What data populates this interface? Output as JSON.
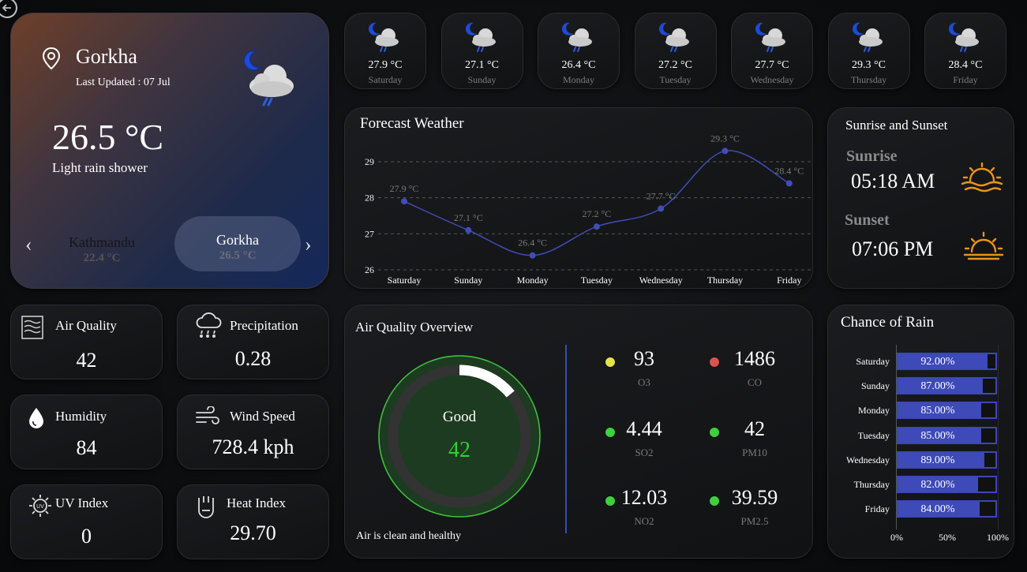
{
  "main": {
    "city": "Gorkha",
    "last_updated": "Last Updated : 07 Jul",
    "temperature": "26.5 °C",
    "condition": "Light rain shower",
    "carousel": [
      {
        "city": "Kathmandu",
        "temp": "22.4 °C"
      },
      {
        "city": "Gorkha",
        "temp": "26.5 °C"
      }
    ],
    "prev_arrow": "‹",
    "next_arrow": "›"
  },
  "days": [
    {
      "temp": "27.9 °C",
      "name": "Saturday",
      "icon": "night-cloud-icon"
    },
    {
      "temp": "27.1 °C",
      "name": "Sunday",
      "icon": "night-cloud-icon"
    },
    {
      "temp": "26.4 °C",
      "name": "Monday",
      "icon": "night-cloud-icon"
    },
    {
      "temp": "27.2 °C",
      "name": "Tuesday",
      "icon": "night-cloud-icon"
    },
    {
      "temp": "27.7 °C",
      "name": "Wednesday",
      "icon": "night-cloud-icon"
    },
    {
      "temp": "29.3 °C",
      "name": "Thursday",
      "icon": "night-cloud-icon"
    },
    {
      "temp": "28.4 °C",
      "name": "Friday",
      "icon": "night-cloud-icon"
    }
  ],
  "forecast": {
    "title": "Forecast Weather",
    "chart_data": {
      "type": "line",
      "categories": [
        "Saturday",
        "Sunday",
        "Monday",
        "Tuesday",
        "Wednesday",
        "Thursday",
        "Friday"
      ],
      "values": [
        27.9,
        27.1,
        26.4,
        27.2,
        27.7,
        29.3,
        28.4
      ],
      "labels": [
        "27.9 °C",
        "27.1 °C",
        "26.4 °C",
        "27.2 °C",
        "27.7 °C",
        "29.3 °C",
        "28.4 °C"
      ],
      "yticks": [
        "29",
        "28",
        "27",
        "26"
      ],
      "ylim": [
        26,
        29
      ],
      "grid": true,
      "color": "#3f4db8"
    }
  },
  "sun": {
    "title": "Sunrise and Sunset",
    "sunrise_label": "Sunrise",
    "sunrise_time": "05:18 AM",
    "sunset_label": "Sunset",
    "sunset_time": "07:06 PM",
    "icon_color": "#e8941a"
  },
  "stats": {
    "air_quality": {
      "label": "Air Quality",
      "value": "42"
    },
    "precipitation": {
      "label": "Precipitation",
      "value": "0.28"
    },
    "humidity": {
      "label": "Humidity",
      "value": "84"
    },
    "wind_speed": {
      "label": "Wind Speed",
      "value": "728.4 kph"
    },
    "uv_index": {
      "label": "UV Index",
      "value": "0"
    },
    "heat_index": {
      "label": "Heat Index",
      "value": "29.70"
    }
  },
  "aq": {
    "title": "Air Quality Overview",
    "status": "Good",
    "value": "42",
    "gauge_fraction": 0.14,
    "footer": "Air is clean and healthy",
    "items": [
      {
        "value": "93",
        "label": "O3",
        "color": "#e6e24e"
      },
      {
        "value": "1486",
        "label": "CO",
        "color": "#d9534f"
      },
      {
        "value": "4.44",
        "label": "SO2",
        "color": "#3dd13d"
      },
      {
        "value": "42",
        "label": "PM10",
        "color": "#3dd13d"
      },
      {
        "value": "12.03",
        "label": "NO2",
        "color": "#3dd13d"
      },
      {
        "value": "39.59",
        "label": "PM2.5",
        "color": "#3dd13d"
      }
    ]
  },
  "rain": {
    "title": "Chance of Rain",
    "chart_data": {
      "type": "bar",
      "categories": [
        "Saturday",
        "Sunday",
        "Monday",
        "Tuesday",
        "Wednesday",
        "Thursday",
        "Friday"
      ],
      "values": [
        92,
        87,
        85,
        85,
        89,
        82,
        84
      ],
      "labels": [
        "92.00%",
        "87.00%",
        "85.00%",
        "85.00%",
        "89.00%",
        "82.00%",
        "84.00%"
      ],
      "xticks": [
        "0%",
        "50%",
        "100%"
      ],
      "xlim": [
        0,
        100
      ],
      "color": "#3d4ab7"
    }
  }
}
